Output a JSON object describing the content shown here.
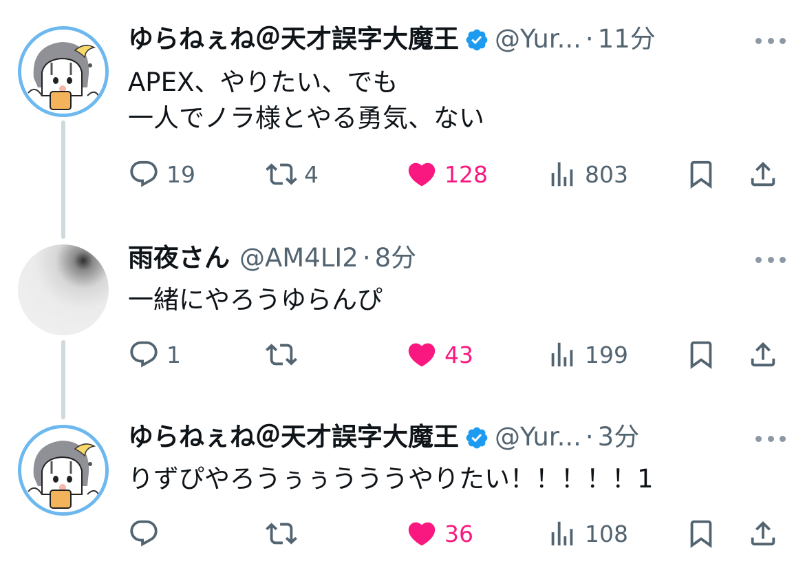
{
  "tweets": [
    {
      "name": "ゆらねぇね＠天才誤字大魔王",
      "handle": "@Yur...",
      "time": "11分",
      "text": "APEX、やりたい、でも\n一人でノラ様とやる勇気、ない",
      "replies": "19",
      "retweets": "4",
      "likes": "128",
      "views": "803",
      "verified": true
    },
    {
      "name": "雨夜さん",
      "handle": "@AM4LI2",
      "time": "8分",
      "text": "一緒にやろうゆらんぴ",
      "replies": "1",
      "retweets": "",
      "likes": "43",
      "views": "199",
      "verified": false
    },
    {
      "name": "ゆらねぇね＠天才誤字大魔王",
      "handle": "@Yur...",
      "time": "3分",
      "text": "りずぴやろうぅぅうううやりたい！！！！！1",
      "replies": "",
      "retweets": "",
      "likes": "36",
      "views": "108",
      "verified": true
    }
  ],
  "separator": "·",
  "icons": {
    "reply": "reply-icon",
    "retweet": "retweet-icon",
    "like": "heart-icon",
    "views": "views-icon",
    "bookmark": "bookmark-icon",
    "share": "share-icon",
    "verified": "verified-badge-icon"
  },
  "colors": {
    "like": "#f91880",
    "verified": "#1d9bf0",
    "muted": "#536471",
    "thread_line": "#cfd9de",
    "avatar_ring": "#6cb8ef"
  }
}
